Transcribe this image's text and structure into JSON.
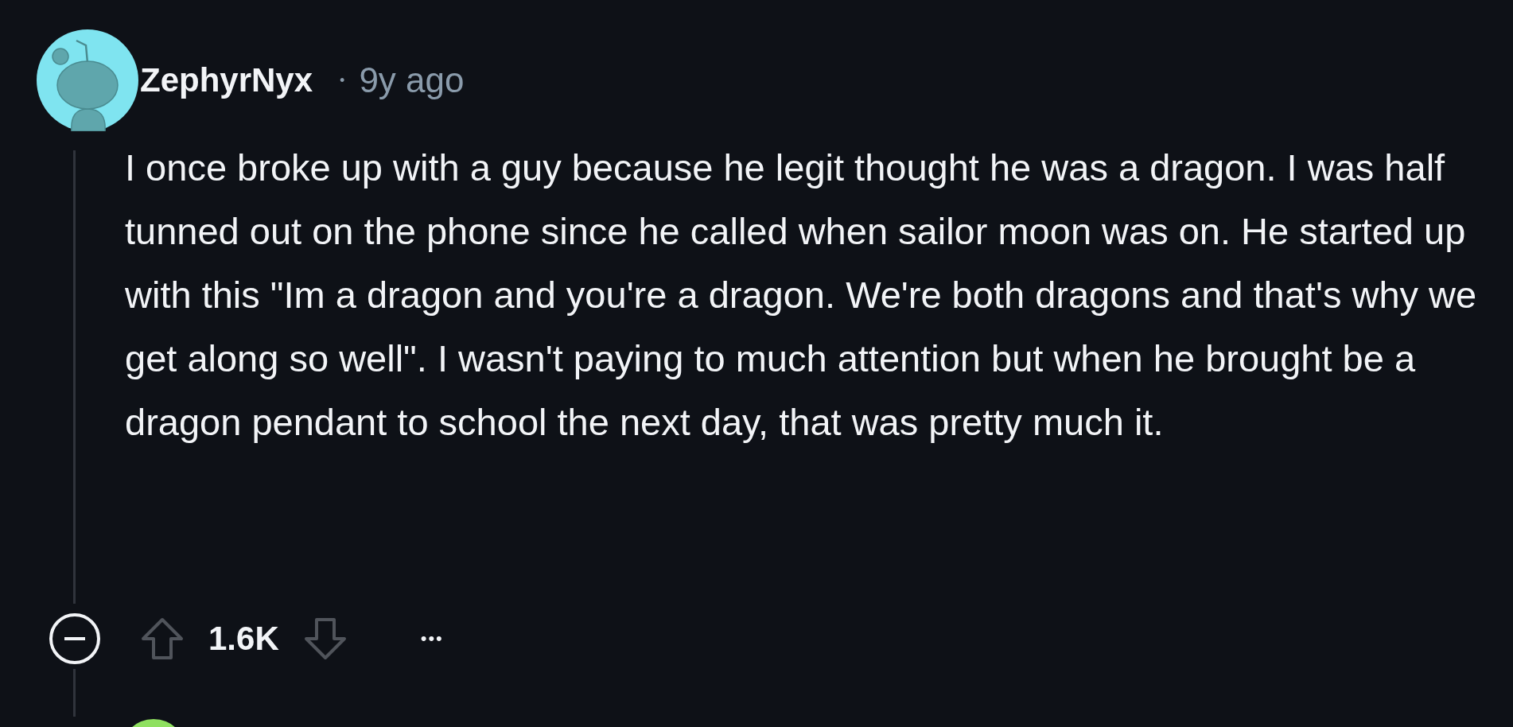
{
  "comment": {
    "author": "ZephyrNyx",
    "separator": "•",
    "time": "9y ago",
    "body": "I once broke up with a guy because he legit thought he was a dragon. I was half tunned out on the phone since he called when sailor moon was on. He started up with this \"Im a dragon and you're a dragon. We're both dragons and that's why we get along so well\". I wasn't paying to much attention but when he brought be a dragon pendant to school the next day, that was pretty much it.",
    "score": "1.6K",
    "more": "•••"
  }
}
